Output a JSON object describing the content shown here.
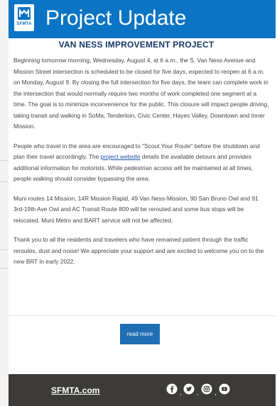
{
  "header": {
    "title": "Project Update",
    "logo_label": "SFMTA"
  },
  "subtitle": "VAN NESS IMPROVEMENT PROJECT",
  "body": {
    "p1": "Beginning tomorrow morning, Wednesday, August 4, at 6 a.m., the S. Van Ness Avenue and Mission Street intersection is scheduled to be closed for five days, expected to reopen at 6 a.m. on Monday, August 9. By closing the full intersection for five days, the team can complete work in the intersection that would normally require two months of work completed one segment at a time. The goal is to minimize inconvenience for the public. This closure will impact people driving, taking transit and walking in SoMa, Tenderloin, Civic Center, Hayes Valley, Downtown and Inner Mission.",
    "p2_before": "People who travel in the area are encouraged to \"Scout Your Route\" before the shutdown and plan their travel accordingly. The ",
    "p2_link": "project website",
    "p2_after": " details the available detours and provides additional information for motorists. While pedestrian access will be maintained at all times, people walking should consider bypassing the area.",
    "p3": "Muni routes 14 Mission, 14R Mission Rapid, 49 Van Ness-Mission, 90 San Bruno Owl and 91 3rd-19th Ave Owl and AC Transit Route 800 will be rerouted and some bus stops will be relocated. Muni Metro and BART service will not be affected.",
    "p4": "Thank you to all the residents and travelers who have remained patient through the traffic reroutes, dust and noise! We appreciate your support and are excited to welcome you on to the new BRT in early 2022."
  },
  "read_more_label": "read more",
  "footer": {
    "link": "SFMTA.com",
    "separator": ",",
    "icons": [
      "facebook-icon",
      "twitter-icon",
      "instagram-icon",
      "youtube-icon"
    ]
  },
  "colors": {
    "header_blue": "#0b74c4",
    "subtitle_navy": "#143a66",
    "button_blue": "#1f6fb5",
    "footer_dark": "#3d3b38"
  }
}
